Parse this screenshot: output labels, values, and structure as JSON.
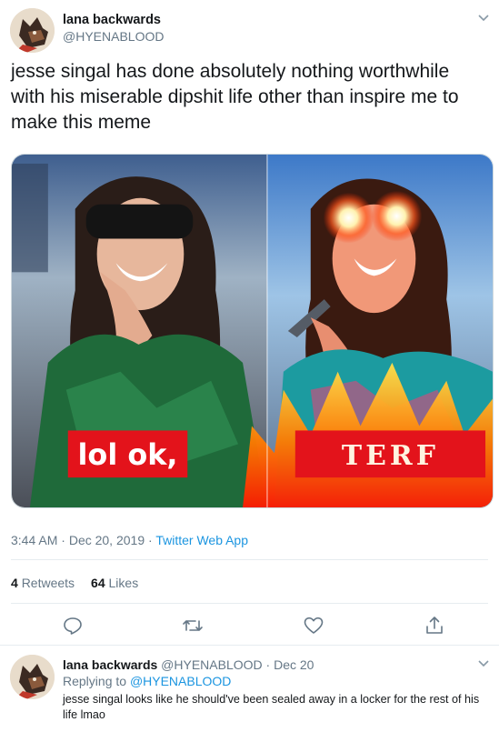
{
  "tweet": {
    "author_name": "lana backwards",
    "author_handle": "@HYENABLOOD",
    "text": "jesse singal has done absolutely nothing worthwhile with his miserable dipshit life other than inspire me to make this meme",
    "media": {
      "left_caption": "lol ok,",
      "right_caption": "TERF"
    },
    "time": "3:44 AM",
    "date": "Dec 20, 2019",
    "separator": "·",
    "app": "Twitter Web App",
    "retweets_count": "4",
    "retweets_label": "Retweets",
    "likes_count": "64",
    "likes_label": "Likes",
    "actions": [
      "reply-icon",
      "retweet-icon",
      "like-icon",
      "share-icon"
    ]
  },
  "reply": {
    "author_name": "lana backwards",
    "author_handle": "@HYENABLOOD",
    "separator": "·",
    "date": "Dec 20",
    "replying_prefix": "Replying to",
    "replying_handle": "@HYENABLOOD",
    "text": "jesse singal looks like he should've been sealed away in a locker for the rest of his life lmao"
  },
  "colors": {
    "text": "#14171a",
    "secondary": "#657786",
    "link": "#1b95e0",
    "divider": "#e6ecf0"
  }
}
